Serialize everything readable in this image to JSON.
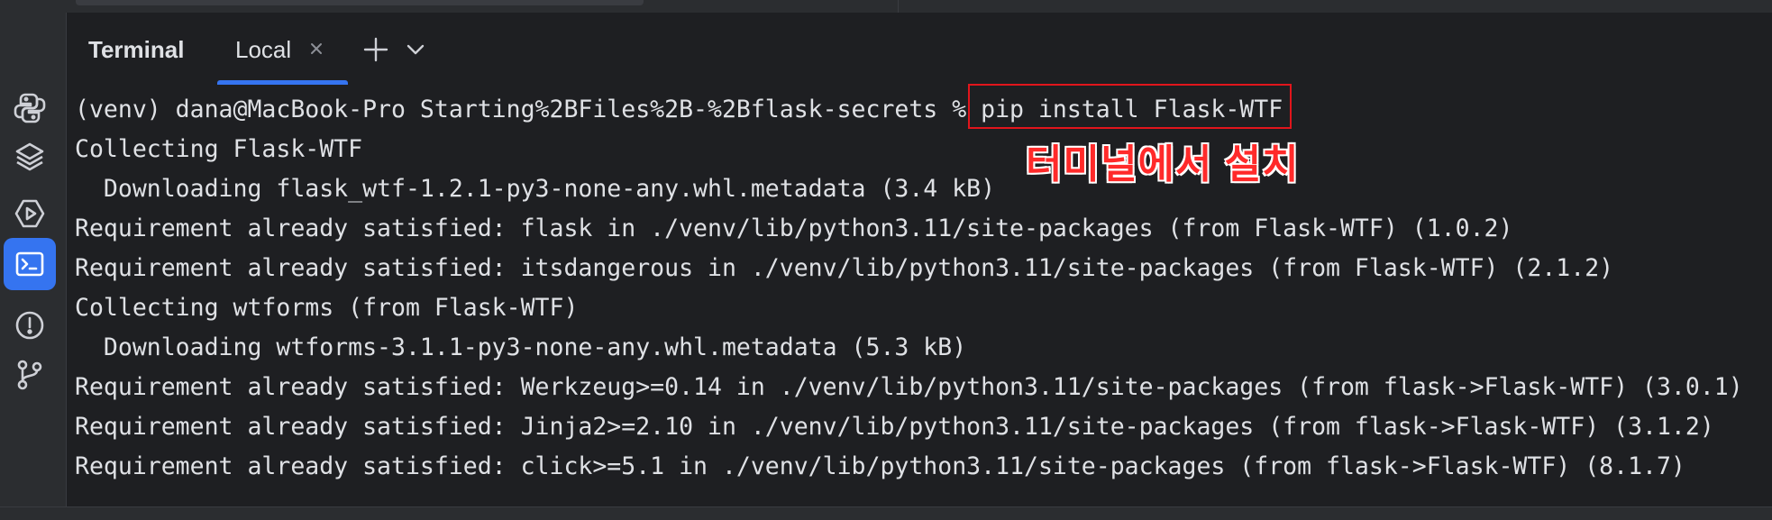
{
  "panel": {
    "title": "Terminal"
  },
  "tabs": [
    {
      "label": "Local",
      "active": true
    }
  ],
  "toolbar": {
    "icons": [
      "close-icon",
      "plus-icon",
      "chevron-down-icon"
    ]
  },
  "sidebar": {
    "items": [
      {
        "icon": "python-icon"
      },
      {
        "icon": "layers-icon"
      },
      {
        "icon": "services-icon"
      },
      {
        "icon": "terminal-icon",
        "active": true
      },
      {
        "icon": "problems-icon"
      },
      {
        "icon": "git-icon"
      }
    ]
  },
  "terminal": {
    "prompt": "(venv) dana@MacBook-Pro Starting%2BFiles%2B-%2Bflask-secrets % ",
    "command": "pip install Flask-WTF",
    "lines": [
      "Collecting Flask-WTF",
      "  Downloading flask_wtf-1.2.1-py3-none-any.whl.metadata (3.4 kB)",
      "Requirement already satisfied: flask in ./venv/lib/python3.11/site-packages (from Flask-WTF) (1.0.2)",
      "Requirement already satisfied: itsdangerous in ./venv/lib/python3.11/site-packages (from Flask-WTF) (2.1.2)",
      "Collecting wtforms (from Flask-WTF)",
      "  Downloading wtforms-3.1.1-py3-none-any.whl.metadata (5.3 kB)",
      "Requirement already satisfied: Werkzeug>=0.14 in ./venv/lib/python3.11/site-packages (from flask->Flask-WTF) (3.0.1)",
      "Requirement already satisfied: Jinja2>=2.10 in ./venv/lib/python3.11/site-packages (from flask->Flask-WTF) (3.1.2)",
      "Requirement already satisfied: click>=5.1 in ./venv/lib/python3.11/site-packages (from flask->Flask-WTF) (8.1.7)"
    ]
  },
  "annotation": {
    "text": "터미널에서 설치",
    "color": "#ff2a2a",
    "box_color": "#e1151c"
  },
  "colors": {
    "background": "#1e1f22",
    "sidebar": "#2b2d30",
    "accent": "#3574f0",
    "text": "#dfe1e5",
    "icon": "#ced0d6"
  }
}
